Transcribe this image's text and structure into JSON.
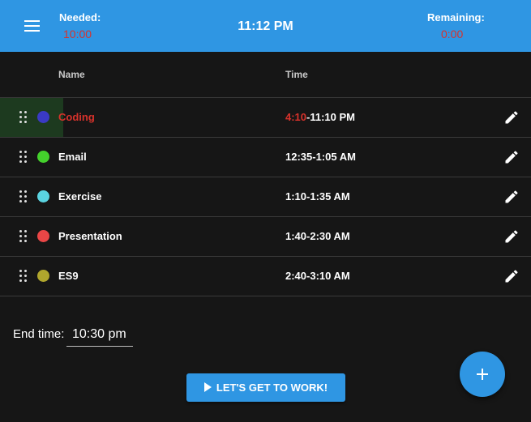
{
  "header": {
    "menu_icon": "hamburger-menu-icon",
    "needed_label": "Needed:",
    "needed_value": "10:00",
    "clock": "11:12 PM",
    "remaining_label": "Remaining:",
    "remaining_value": "0:00",
    "bar_color": "#2f96e3",
    "alert_color": "#d8322b"
  },
  "table": {
    "columns": {
      "name": "Name",
      "time": "Time"
    },
    "tasks": [
      {
        "name": "Coding",
        "time_start": "4:10",
        "time_end": "-11:10 PM",
        "color": "#3a3ac4",
        "active": true
      },
      {
        "name": "Email",
        "time_start": "",
        "time_end": "12:35-1:05 AM",
        "color": "#44d12c",
        "active": false
      },
      {
        "name": "Exercise",
        "time_start": "",
        "time_end": "1:10-1:35 AM",
        "color": "#5ad3e0",
        "active": false
      },
      {
        "name": "Presentation",
        "time_start": "",
        "time_end": "1:40-2:30 AM",
        "color": "#ea4646",
        "active": false
      },
      {
        "name": "ES9",
        "time_start": "",
        "time_end": "2:40-3:10 AM",
        "color": "#b0a62d",
        "active": false
      }
    ],
    "row_icons": {
      "drag": "drag-handle-icon",
      "edit": "pencil-icon"
    }
  },
  "end_time": {
    "label": "End time:",
    "value": "10:30 pm"
  },
  "start_button": {
    "label": "LET'S GET TO WORK!",
    "icon": "play-icon"
  },
  "fab": {
    "icon": "plus-icon"
  }
}
